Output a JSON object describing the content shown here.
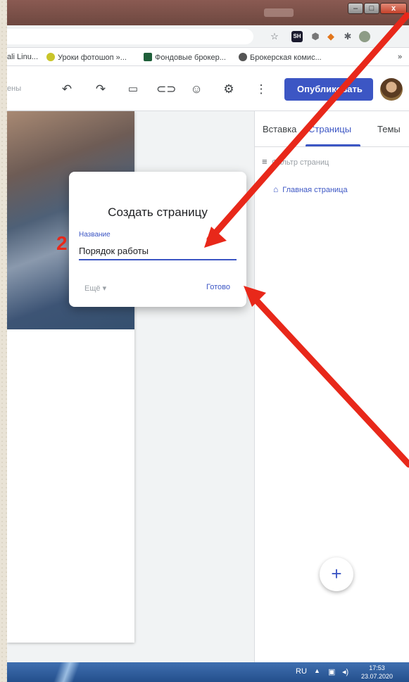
{
  "browser": {
    "bookmarks": [
      "ali Linu...",
      "Уроки фотошоп »...",
      "Фондовые брокер...",
      "Брокерская комис..."
    ],
    "bookmarks_more": "»"
  },
  "toolbar": {
    "saved_status": "ены",
    "publish_label": "Опубликовать"
  },
  "panel": {
    "tabs": [
      "Вставка",
      "Страницы",
      "Темы"
    ],
    "active_tab": "Страницы",
    "filter_placeholder": "Фильтр страниц",
    "pages": [
      "Главная страница"
    ]
  },
  "dialog": {
    "title": "Создать страницу",
    "field_label": "Название",
    "field_value": "Порядок работы",
    "more_label": "Ещё",
    "done_label": "Готово"
  },
  "annotation": {
    "step": "2"
  },
  "taskbar": {
    "lang": "RU",
    "time": "17:53",
    "date": "23.07.2020"
  },
  "colors": {
    "accent": "#3c56c4",
    "arrow": "#e8281a"
  }
}
